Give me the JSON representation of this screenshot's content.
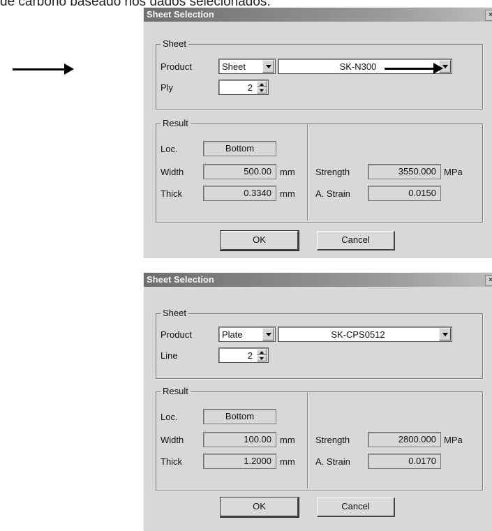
{
  "caption": "de carbono baseado nos dados selecionados:",
  "dialogs": [
    {
      "title": "Sheet Selection",
      "sheet_group": "Sheet",
      "product_label": "Product",
      "product_type": "Sheet",
      "product_name": "SK-N300",
      "spin_label": "Ply",
      "spin_value": "2",
      "result_group": "Result",
      "loc_label": "Loc.",
      "loc_value": "Bottom",
      "width_label": "Width",
      "width_value": "500.00",
      "width_unit": "mm",
      "thick_label": "Thick",
      "thick_value": "0.3340",
      "thick_unit": "mm",
      "strength_label": "Strength",
      "strength_value": "3550.000",
      "strength_unit": "MPa",
      "strain_label": "A. Strain",
      "strain_value": "0.0150",
      "ok_label": "OK",
      "cancel_label": "Cancel"
    },
    {
      "title": "Sheet Selection",
      "sheet_group": "Sheet",
      "product_label": "Product",
      "product_type": "Plate",
      "product_name": "SK-CPS0512",
      "spin_label": "Line",
      "spin_value": "2",
      "result_group": "Result",
      "loc_label": "Loc.",
      "loc_value": "Bottom",
      "width_label": "Width",
      "width_value": "100.00",
      "width_unit": "mm",
      "thick_label": "Thick",
      "thick_value": "1.2000",
      "thick_unit": "mm",
      "strength_label": "Strength",
      "strength_value": "2800.000",
      "strength_unit": "MPa",
      "strain_label": "A. Strain",
      "strain_value": "0.0170",
      "ok_label": "OK",
      "cancel_label": "Cancel"
    }
  ],
  "icons": {
    "annotation_arrow": "arrow-right-icon",
    "dropdown": "chevron-down-icon",
    "spinner": "spin-updown-icon",
    "close": "close-icon"
  }
}
